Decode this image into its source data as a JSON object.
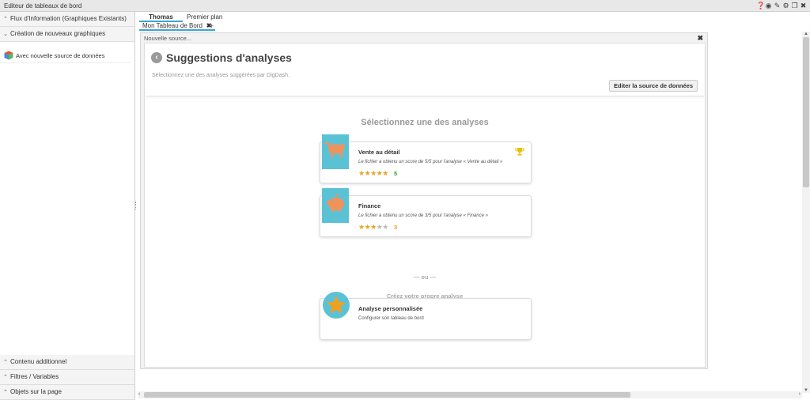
{
  "window": {
    "title": "Editeur de tableaux de bord",
    "icons": [
      "help-icon",
      "eye-icon",
      "edit-icon",
      "settings-icon",
      "restore-icon",
      "close-icon"
    ]
  },
  "sidebar": {
    "sections": [
      {
        "label": "Flux d'Information (Graphiques Existants)",
        "state": "collapsed"
      },
      {
        "label": "Création de nouveaux graphiques",
        "state": "expanded"
      }
    ],
    "items": [
      {
        "label": "Avec nouvelle source de données"
      }
    ],
    "bottom_sections": [
      {
        "label": "Contenu additionnel"
      },
      {
        "label": "Filtres / Variables"
      },
      {
        "label": "Objets sur la page"
      }
    ]
  },
  "tabs": {
    "users": [
      {
        "label": "Thomas",
        "active": true
      },
      {
        "label": "Premier plan",
        "active": false
      }
    ],
    "pages": [
      {
        "label": "Mon Tableau de Bord",
        "active": true
      }
    ],
    "add_label": "+"
  },
  "wizard": {
    "title": "Nouvelle source...",
    "header": {
      "title": "Suggestions d'analyses",
      "subtitle": "Sélectionnez une des analyses suggérées par DigDash.",
      "edit_button": "Editer la source de données"
    },
    "select_title": "Sélectionnez une des analyses",
    "cards": [
      {
        "title": "Vente au détail",
        "description": "Le fichier a obtenu un score de 5/5 pour l'analyse « Vente au détail »",
        "rating": 5,
        "max": 5,
        "score": "5",
        "score_color": "#28a428",
        "icon": "cart-icon",
        "best": true
      },
      {
        "title": "Finance",
        "description": "Le fichier a obtenu un score de 3/5 pour l'analyse « Finance »",
        "rating": 3,
        "max": 5,
        "score": "3",
        "score_color": "#f0a020",
        "icon": "piggy-bank-icon",
        "best": false
      }
    ],
    "separator": "— ou —",
    "own_title": "Créez votre propre analyse",
    "custom": {
      "title": "Analyse personnalisée",
      "description": "Configurer son tableau de bord",
      "icon": "star-icon"
    }
  },
  "colors": {
    "accent": "#3aa6d0",
    "icon_bg": "#5bc2d6",
    "icon_fg": "#f0925a",
    "star": "#f0a020",
    "trophy": "#e8c000"
  }
}
